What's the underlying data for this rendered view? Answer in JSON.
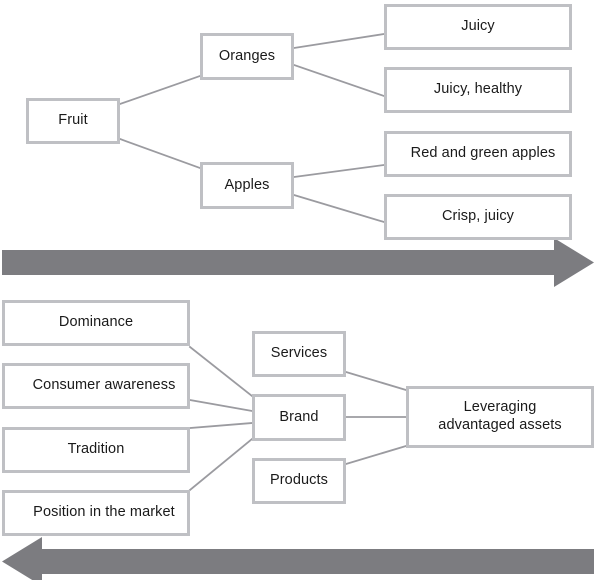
{
  "diagram": {
    "type": "two-part concept map",
    "border_color": "#bfc0c4",
    "arrow_color": "#7c7c80",
    "text_color": "#1a1a1a",
    "background_color": "#ffffff"
  },
  "top_diagram": {
    "name": "fruit-hierarchy",
    "root": {
      "label": "Fruit"
    },
    "branches": [
      {
        "label": "Oranges",
        "attributes": [
          {
            "label": "Juicy"
          },
          {
            "label": "Juicy, healthy"
          }
        ]
      },
      {
        "label": "Apples",
        "attributes": [
          {
            "label": "Red and green apples"
          },
          {
            "label": "Crisp, juicy"
          }
        ]
      }
    ],
    "arrow": {
      "direction": "right",
      "label": ""
    }
  },
  "bottom_diagram": {
    "name": "brand-leverage-map",
    "inputs": [
      {
        "label": "Dominance"
      },
      {
        "label": "Consumer awareness"
      },
      {
        "label": "Tradition"
      },
      {
        "label": "Position in the market"
      }
    ],
    "hub": {
      "label": "Brand"
    },
    "hub_siblings": [
      {
        "label": "Services"
      },
      {
        "label": "Products"
      }
    ],
    "outcome": {
      "label": "Leveraging\nadvantaged assets"
    },
    "arrow": {
      "direction": "left",
      "label": ""
    }
  }
}
